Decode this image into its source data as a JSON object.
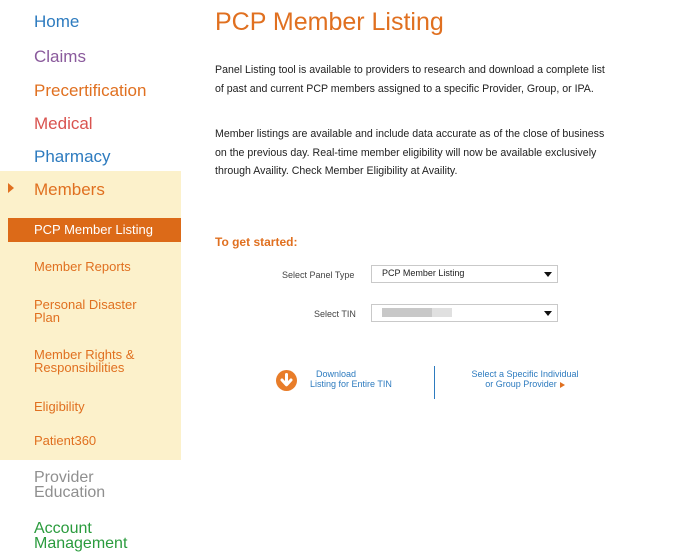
{
  "nav": {
    "home": "Home",
    "claims": "Claims",
    "precertification": "Precertification",
    "medical": "Medical",
    "pharmacy": "Pharmacy",
    "members": "Members",
    "provider_education": [
      "Provider",
      "Education"
    ],
    "account_management": [
      "Account",
      "Management"
    ]
  },
  "members_submenu": {
    "pcp_member_listing": "PCP Member Listing",
    "member_reports": "Member Reports",
    "personal_disaster_plan": [
      "Personal Disaster",
      "Plan"
    ],
    "member_rights": [
      "Member Rights &",
      "Responsibilities"
    ],
    "eligibility": "Eligibility",
    "patient360": "Patient360"
  },
  "main": {
    "title": "PCP Member Listing",
    "para1": [
      "Panel Listing tool is available to providers to research and download a complete list",
      "of past and current PCP members assigned to a specific Provider, Group, or IPA."
    ],
    "para2": [
      "Member listings are available and include data accurate as of the close of business",
      "on the previous day. Real-time member eligibility will now be available exclusively",
      "through Availity. Check Member Eligibility at Availity."
    ],
    "get_started": "To get started:",
    "panel_type_label": "Select Panel Type",
    "panel_type_value": "PCP Member Listing",
    "tin_label": "Select TIN",
    "download_text": [
      "Download",
      "Listing for Entire TIN"
    ],
    "select_provider_text": [
      "Select a Specific Individual",
      "or Group Provider"
    ]
  },
  "colors": {
    "orange": "#e07020",
    "blue": "#2d7bbf",
    "green": "#2a9b3d",
    "panel_bg": "#fcf1cb",
    "active_bg": "#dc6a18"
  },
  "icons": {
    "members_arrow": "triangle-right-icon",
    "download": "download-circle-icon",
    "dropdown": "chevron-down-icon",
    "provider_arrow": "triangle-right-icon"
  }
}
